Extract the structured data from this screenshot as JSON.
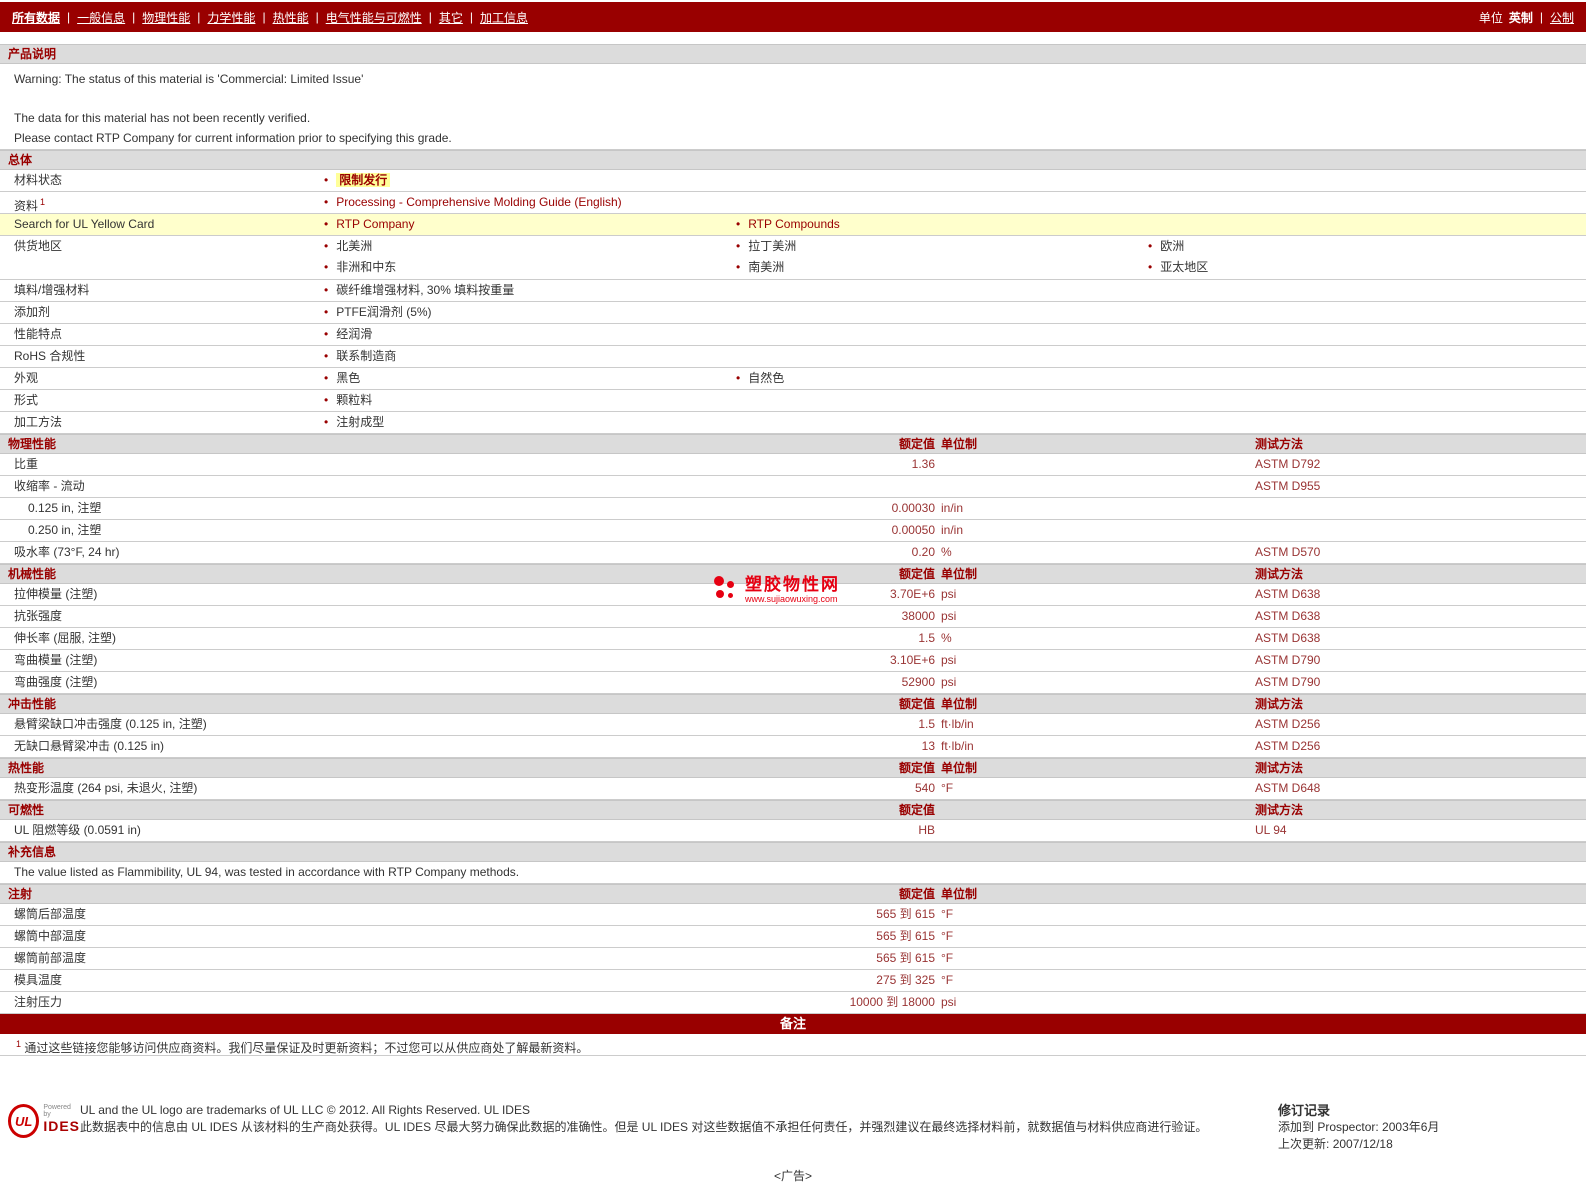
{
  "nav": {
    "items": [
      "所有数据",
      "一般信息",
      "物理性能",
      "力学性能",
      "热性能",
      "电气性能与可燃性",
      "其它",
      "加工信息"
    ],
    "units_label": "单位",
    "unit_english": "英制",
    "unit_metric": "公制"
  },
  "colors": {
    "accent": "#990000",
    "header_bg": "#dcdcdc",
    "badge_highlight": "#ffff99",
    "row_highlight": "#ffffcc",
    "watermark_red": "#e60012"
  },
  "watermark": {
    "name": "塑胶物性网",
    "url": "www.sujiaowuxing.com"
  },
  "product_desc": {
    "title": "产品说明",
    "line1": "Warning: The status of this material is 'Commercial: Limited Issue'",
    "line2": "The data for this material has not been recently verified.",
    "line3": "Please contact RTP Company for current information prior to specifying this grade."
  },
  "general": {
    "title": "总体",
    "rows": {
      "status": {
        "label": "材料状态",
        "value": "限制发行"
      },
      "resources": {
        "label": "资料",
        "sup": "1",
        "value": "Processing - Comprehensive Molding Guide (English)"
      },
      "yellowcard": {
        "label": "Search for UL Yellow Card",
        "c1": "RTP Company",
        "c2": "RTP Compounds"
      },
      "regions": {
        "label": "供货地区",
        "c1a": "北美洲",
        "c1b": "非洲和中东",
        "c2a": "拉丁美洲",
        "c2b": "南美洲",
        "c3a": "欧洲",
        "c3b": "亚太地区"
      },
      "filler": {
        "label": "填料/增强材料",
        "value": "碳纤维增强材料, 30% 填料按重量"
      },
      "additive": {
        "label": "添加剂",
        "value": "PTFE润滑剂 (5%)"
      },
      "features": {
        "label": "性能特点",
        "value": "经润滑"
      },
      "rohs": {
        "label": "RoHS 合规性",
        "value": "联系制造商"
      },
      "appearance": {
        "label": "外观",
        "c1": "黑色",
        "c2": "自然色"
      },
      "forms": {
        "label": "形式",
        "value": "颗粒料"
      },
      "processing": {
        "label": "加工方法",
        "value": "注射成型"
      }
    }
  },
  "physical": {
    "title": "物理性能",
    "col_value": "额定值",
    "col_unit": "单位制",
    "col_test": "测试方法",
    "rows": [
      {
        "label": "比重",
        "value": "1.36",
        "unit": "",
        "test": "ASTM D792"
      },
      {
        "label": "收缩率 - 流动",
        "value": "",
        "unit": "",
        "test": "ASTM D955"
      },
      {
        "label": "0.125 in, 注塑",
        "value": "0.00030",
        "unit": "in/in",
        "test": ""
      },
      {
        "label": "0.250 in, 注塑",
        "value": "0.00050",
        "unit": "in/in",
        "test": ""
      },
      {
        "label": "吸水率 (73°F, 24 hr)",
        "value": "0.20",
        "unit": "%",
        "test": "ASTM D570"
      }
    ]
  },
  "mechanical": {
    "title": "机械性能",
    "col_value": "额定值",
    "col_unit": "单位制",
    "col_test": "测试方法",
    "rows": [
      {
        "label": "拉伸模量 (注塑)",
        "value": "3.70E+6",
        "unit": "psi",
        "test": "ASTM D638"
      },
      {
        "label": "抗张强度",
        "value": "38000",
        "unit": "psi",
        "test": "ASTM D638"
      },
      {
        "label": "伸长率 (屈服, 注塑)",
        "value": "1.5",
        "unit": "%",
        "test": "ASTM D638"
      },
      {
        "label": "弯曲模量 (注塑)",
        "value": "3.10E+6",
        "unit": "psi",
        "test": "ASTM D790"
      },
      {
        "label": "弯曲强度 (注塑)",
        "value": "52900",
        "unit": "psi",
        "test": "ASTM D790"
      }
    ]
  },
  "impact": {
    "title": "冲击性能",
    "col_value": "额定值",
    "col_unit": "单位制",
    "col_test": "测试方法",
    "rows": [
      {
        "label": "悬臂梁缺口冲击强度 (0.125 in, 注塑)",
        "value": "1.5",
        "unit": "ft·lb/in",
        "test": "ASTM D256"
      },
      {
        "label": "无缺口悬臂梁冲击 (0.125 in)",
        "value": "13",
        "unit": "ft·lb/in",
        "test": "ASTM D256"
      }
    ]
  },
  "thermal": {
    "title": "热性能",
    "col_value": "额定值",
    "col_unit": "单位制",
    "col_test": "测试方法",
    "rows": [
      {
        "label": "热变形温度 (264 psi, 未退火, 注塑)",
        "value": "540",
        "unit": "°F",
        "test": "ASTM D648"
      }
    ]
  },
  "flammability": {
    "title": "可燃性",
    "col_value": "额定值",
    "col_test": "测试方法",
    "rows": [
      {
        "label": "UL 阻燃等级 (0.0591 in)",
        "value": "HB",
        "unit": "",
        "test": "UL 94"
      }
    ]
  },
  "supplemental": {
    "title": "补充信息",
    "text": "The value listed as Flammibility, UL 94, was tested in accordance with RTP Company methods."
  },
  "injection": {
    "title": "注射",
    "col_value": "额定值",
    "col_unit": "单位制",
    "rows": [
      {
        "label": "螺筒后部温度",
        "value": "565 到 615",
        "unit": "°F"
      },
      {
        "label": "螺筒中部温度",
        "value": "565 到 615",
        "unit": "°F"
      },
      {
        "label": "螺筒前部温度",
        "value": "565 到 615",
        "unit": "°F"
      },
      {
        "label": "模具温度",
        "value": "275 到 325",
        "unit": "°F"
      },
      {
        "label": "注射压力",
        "value": "10000 到 18000",
        "unit": "psi"
      }
    ]
  },
  "notes": {
    "title": "备注",
    "sup": "1",
    "text": "通过这些链接您能够访问供应商资料。我们尽量保证及时更新资料；不过您可以从供应商处了解最新资料。"
  },
  "footer": {
    "logo_ul": "UL",
    "logo_powered": "Powered by",
    "logo_ides": "IDES",
    "line1": "UL and the UL logo are trademarks of UL LLC © 2012. All Rights Reserved. UL IDES",
    "line2": "此数据表中的信息由 UL IDES 从该材料的生产商处获得。UL IDES 尽最大努力确保此数据的准确性。但是 UL IDES 对这些数据值不承担任何责任，并强烈建议在最终选择材料前，就数据值与材料供应商进行验证。",
    "revision_title": "修订记录",
    "revision_added": "添加到 Prospector:",
    "revision_added_value": "2003年6月",
    "revision_updated": "上次更新:",
    "revision_updated_value": "2007/12/18"
  },
  "ad": {
    "text": "<广告>"
  }
}
